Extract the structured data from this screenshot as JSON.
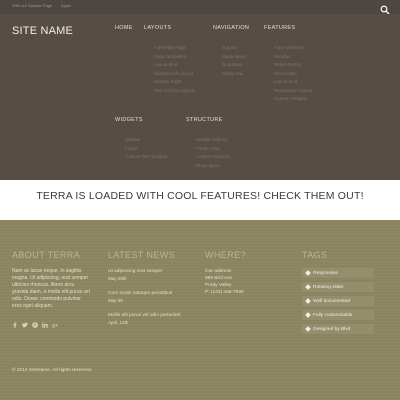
{
  "topbar": {
    "links": [
      "With our Sample Page",
      "Apple"
    ]
  },
  "header": {
    "site_name": "SITE NAME",
    "nav": [
      "HOME",
      "LAYOUTS",
      "NAVIGATION",
      "FEATURES"
    ],
    "layouts_sub": [
      "Full Width Page",
      "Page Templates",
      "Layout Grid",
      "Sidebar Left Layout",
      "Sidebar Right",
      "One Column Layout"
    ],
    "navigation_sub": [
      "Top Bar",
      "Mega Menu",
      "Dropdown",
      "Sticky Nav"
    ],
    "features_sub": [
      "Font Awesome",
      "Parallax",
      "Retina Ready",
      "Shortcodes",
      "Layout Grid",
      "Responsive Layout",
      "Custom Widgets"
    ],
    "widgets_head": "WIDGETS",
    "structure_head": "STRUCTURE",
    "widgets_sub": [
      "Sidebar",
      "Footer",
      "Custom Text Widgets"
    ],
    "structure_sub": [
      "Header Options",
      "Footer Area",
      "Content Sections",
      "Blog Layout"
    ]
  },
  "banner": {
    "text": "TERRA IS LOADED WITH COOL FEATURES! CHECK THEM OUT!"
  },
  "footer": {
    "about": {
      "title": "ABOUT TERRA",
      "text": "Nam ac lacus neque. In sagittis magna. Ut adipiscing, erat semper ultricies rhoncus, libero arcu gravida diam, a mollis elit purus vel odio. Donec commodo pulvinar eros eget aliquam.",
      "social": [
        "facebook-icon",
        "twitter-icon",
        "pinterest-icon",
        "linkedin-icon",
        "google-plus-icon"
      ]
    },
    "news": {
      "title": "LATEST NEWS",
      "items": [
        {
          "title": "Ut adipiscing erat semper",
          "date": "May 29th"
        },
        {
          "title": "Cum sociis natoque penatibus",
          "date": "May 08"
        },
        {
          "title": "Mollis elit purus vel odio parturient",
          "date": "April, 12th"
        }
      ]
    },
    "where": {
      "title": "WHERE?",
      "lines": [
        "Our address",
        "999 Bird Ave.",
        "Pretty Valley",
        "P: (123) 456-7890"
      ]
    },
    "tags": {
      "title": "TAGS",
      "items": [
        "Responsive",
        "Rotating slider",
        "Well documented",
        "Fully customizable",
        "Designed by Blvd"
      ]
    },
    "copyright": "© 2014 SiteName. All rights reserved."
  }
}
